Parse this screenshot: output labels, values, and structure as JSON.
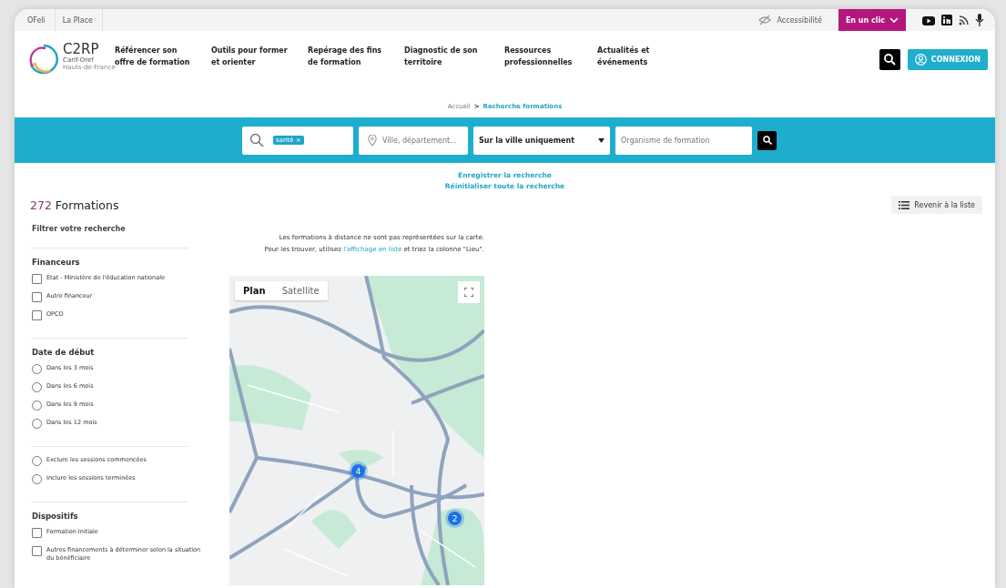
{
  "top_bar": {
    "links": [
      "OFeli",
      "La Place"
    ],
    "accessibility": "Accessibilité",
    "quick_menu": "En un clic"
  },
  "header": {
    "logo": {
      "name": "C2RP",
      "subtitle": "Carif-Oref",
      "region": "Hauts-de-France"
    },
    "nav": [
      "Référencer son offre de formation",
      "Outils pour former et orienter",
      "Repérage des fins de formation",
      "Diagnostic de son territoire",
      "Ressources professionnelles",
      "Actualités et événements"
    ],
    "login": "CONNEXION"
  },
  "breadcrumb_separator": ">",
  "breadcrumb": [
    {
      "label": "Accueil",
      "current": false
    },
    {
      "label": "Recherche formations",
      "current": true
    }
  ],
  "search": {
    "tag": "santé",
    "tag_remove": "×",
    "location_placeholder": "Ville, département...",
    "scope": "Sur la ville uniquement",
    "organism_placeholder": "Organisme de formation"
  },
  "actions": [
    "Enregistrer la recherche",
    "Réinitialiser toute la recherche"
  ],
  "results": {
    "count": "272",
    "label": "Formations",
    "list_button": "Revenir à la liste"
  },
  "filters": {
    "title": "Filtrer votre recherche",
    "groups": [
      {
        "title": "Financeurs",
        "kind": "checkbox",
        "options": [
          {
            "label": "Etat - Ministère de l'éducation nationale",
            "checked": false
          },
          {
            "label": "Autre financeur",
            "checked": false
          },
          {
            "label": "OPCO",
            "checked": false
          }
        ]
      },
      {
        "title": "Date de début",
        "kind": "radio",
        "options": [
          {
            "label": "Dans les 3 mois",
            "checked": false
          },
          {
            "label": "Dans les 6 mois",
            "checked": false
          },
          {
            "label": "Dans les 9 mois",
            "checked": false
          },
          {
            "label": "Dans les 12 mois",
            "checked": false
          }
        ]
      },
      {
        "kind": "radio",
        "options": [
          {
            "label": "Exclure les sessions commencées",
            "checked": false
          },
          {
            "label": "Inclure les sessions terminées",
            "checked": false
          }
        ]
      },
      {
        "title": "Dispositifs",
        "kind": "checkbox",
        "options": [
          {
            "label": "Formation Initiale",
            "checked": false
          },
          {
            "label": "Autres financements à déterminer selon la situation du bénéficiaire",
            "checked": false
          }
        ]
      }
    ]
  },
  "map": {
    "notice": "Les formations à distance ne sont pas représentées sur la carte.\nPour les trouver, utilisez **l'affichage en liste** et triez la colonne \"Lieu\".",
    "types": [
      {
        "label": "Plan",
        "selected": true
      },
      {
        "label": "Satellite",
        "selected": false
      }
    ],
    "clusters": [
      "4",
      "2"
    ]
  }
}
